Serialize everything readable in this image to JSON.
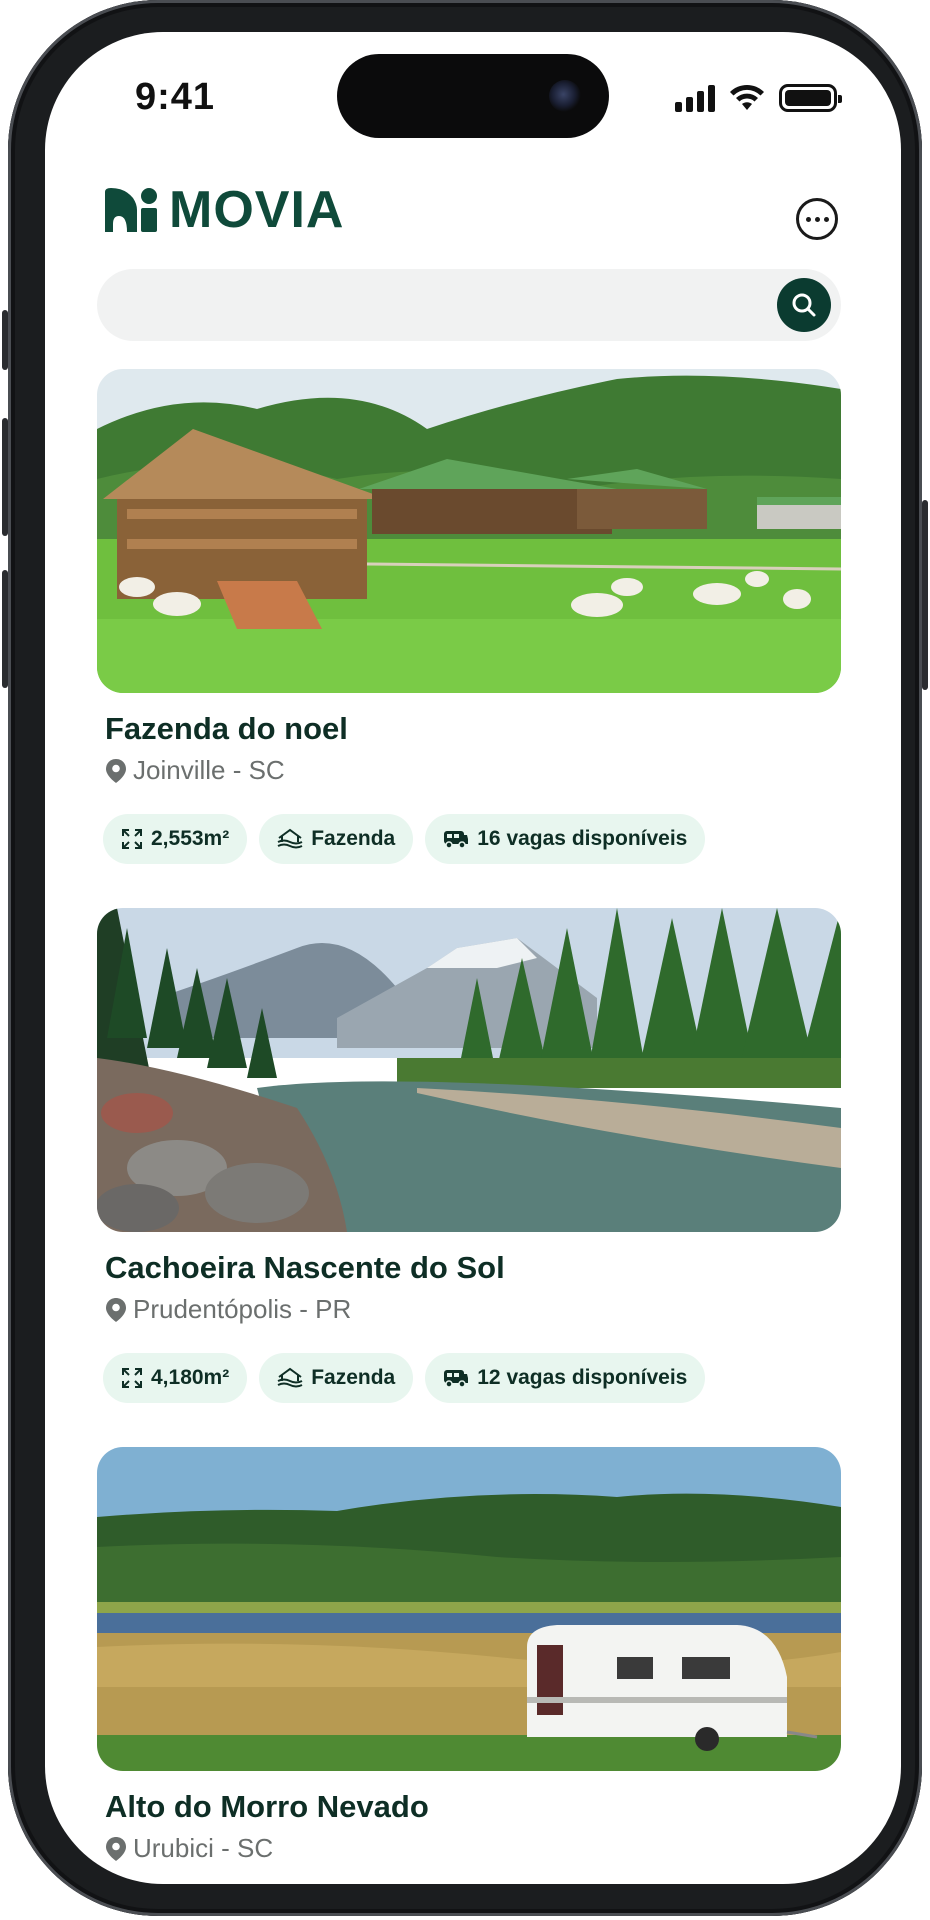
{
  "status_bar": {
    "time": "9:41"
  },
  "app": {
    "name": "MOVIA",
    "accent": "#0f4a3a",
    "chip_bg": "#e8f6ef"
  },
  "search": {
    "placeholder": "",
    "icon": "search-icon"
  },
  "listings": [
    {
      "title": "Fazenda do noel",
      "location": "Joinville - SC",
      "area": "2,553m²",
      "type": "Fazenda",
      "vacancies": "16 vagas disponíveis",
      "image": "farm-with-goats-photo"
    },
    {
      "title": "Cachoeira Nascente do Sol",
      "location": "Prudentópolis - PR",
      "area": "4,180m²",
      "type": "Fazenda",
      "vacancies": "12 vagas disponíveis",
      "image": "mountain-river-photo"
    },
    {
      "title": "Alto do Morro Nevado",
      "location": "Urubici - SC",
      "image": "caravan-by-lake-photo"
    }
  ]
}
